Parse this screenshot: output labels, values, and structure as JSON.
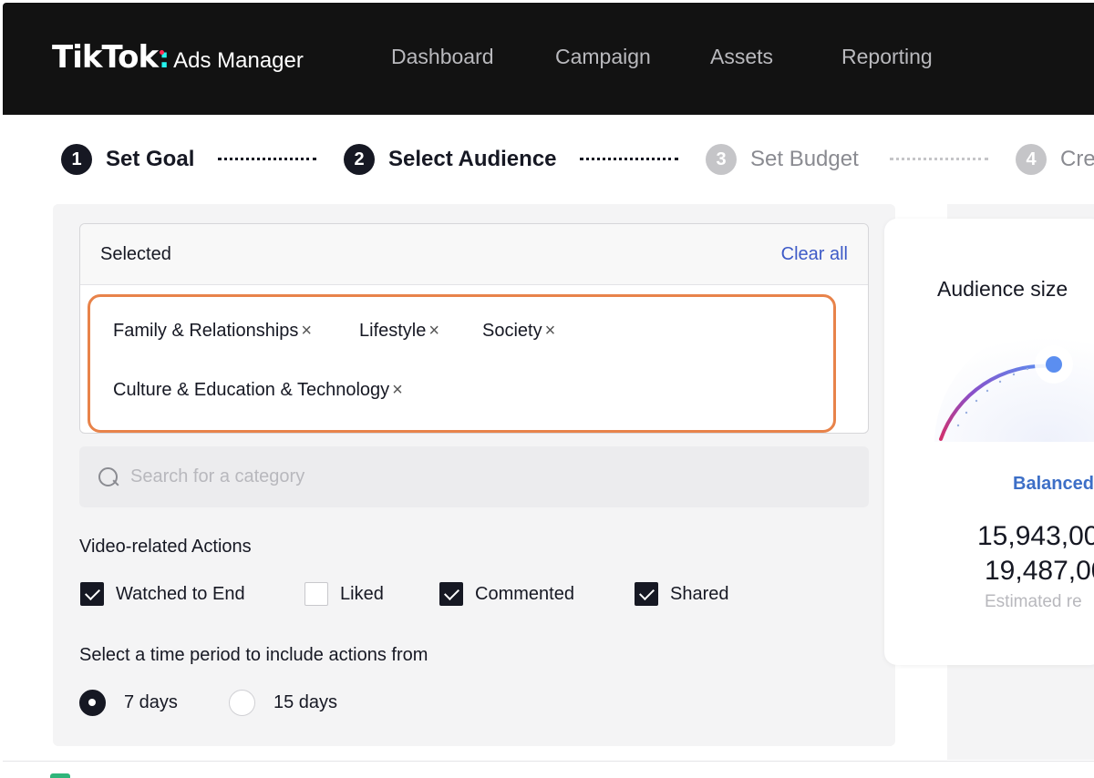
{
  "app": {
    "logo_word": "TikTok",
    "logo_colon": ":",
    "logo_sub": "Ads Manager"
  },
  "nav": [
    {
      "label": "Dashboard"
    },
    {
      "label": "Campaign"
    },
    {
      "label": "Assets"
    },
    {
      "label": "Reporting"
    }
  ],
  "steps": [
    {
      "num": "1",
      "label": "Set Goal",
      "active": true
    },
    {
      "num": "2",
      "label": "Select Audience",
      "active": true
    },
    {
      "num": "3",
      "label": "Set Budget",
      "active": false
    },
    {
      "num": "4",
      "label": "Cre",
      "active": false
    }
  ],
  "selected": {
    "title": "Selected",
    "clear_label": "Clear all",
    "tags": [
      {
        "label": "Family & Relationships"
      },
      {
        "label": "Lifestyle"
      },
      {
        "label": "Society"
      },
      {
        "label": "Culture & Education & Technology"
      }
    ],
    "remove_glyph": "×"
  },
  "search": {
    "placeholder": "Search for a category",
    "value": ""
  },
  "video_actions": {
    "label": "Video-related Actions",
    "items": [
      {
        "label": "Watched to End",
        "checked": true
      },
      {
        "label": "Liked",
        "checked": false
      },
      {
        "label": "Commented",
        "checked": true
      },
      {
        "label": "Shared",
        "checked": true
      }
    ]
  },
  "time_period": {
    "label": "Select a time period to include actions from",
    "options": [
      {
        "label": "7 days",
        "selected": true
      },
      {
        "label": "15 days",
        "selected": false
      }
    ]
  },
  "audience": {
    "title": "Audience size",
    "status": "Balanced",
    "min": "15,943,00",
    "max": "19,487,00",
    "sub": "Estimated re"
  },
  "colors": {
    "accent": "#3d5ac7",
    "highlight": "#e8834a",
    "topbar": "#121212"
  }
}
